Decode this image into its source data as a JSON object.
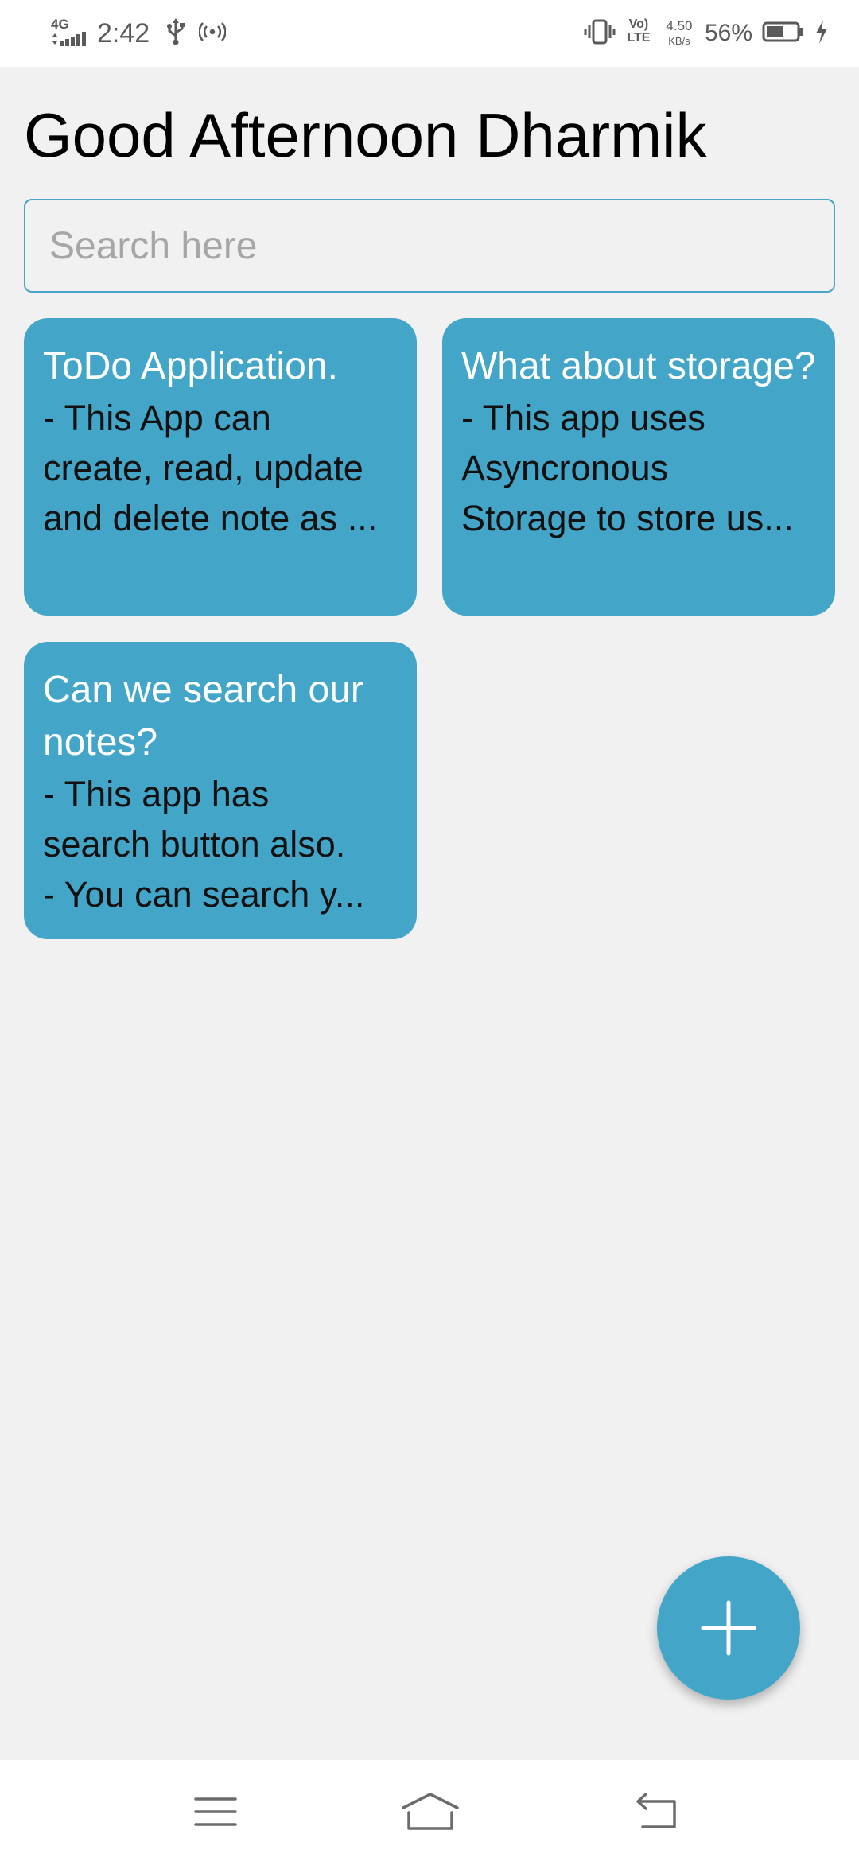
{
  "status_bar": {
    "network_type": "4G",
    "time": "2:42",
    "volte_top": "Vo)",
    "volte_bottom": "LTE",
    "speed_value": "4.50",
    "speed_unit": "KB/s",
    "battery_percent": "56%",
    "battery_level": 0.56,
    "icons": [
      "signal-icon",
      "usb-icon",
      "hotspot-icon",
      "vibrate-icon",
      "volte-icon",
      "battery-icon",
      "charging-icon"
    ]
  },
  "header": {
    "greeting": "Good Afternoon Dharmik"
  },
  "search": {
    "placeholder": "Search here",
    "value": ""
  },
  "notes": [
    {
      "title": "ToDo Application.",
      "body": "- This App can\ncreate, read, update\nand delete note as ..."
    },
    {
      "title": "What about storage?",
      "body": "- This app uses\nAsyncronous\nStorage to store us..."
    },
    {
      "title": "Can we search our notes?",
      "body": "- This app has\nsearch button also.\n- You can search y..."
    }
  ],
  "fab": {
    "icon": "plus-icon"
  },
  "nav_bar": {
    "icons": [
      "menu-icon",
      "home-icon",
      "back-icon"
    ]
  },
  "colors": {
    "accent": "#43a6c9",
    "background": "#f1f1f1",
    "card_title": "#ffffff",
    "card_body": "#111111"
  }
}
